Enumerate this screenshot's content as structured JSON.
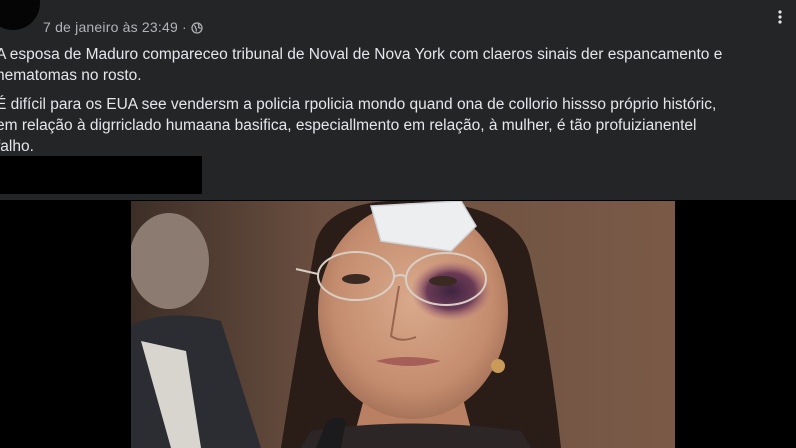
{
  "post": {
    "timestamp": "7 de janeiro às 23:49 ·",
    "paragraphs": [
      "A esposa de Maduro compareceo tribunal de Noval de Nova York com claeros sinais der espancamento e",
      "hematomas no rosto.",
      "É difícil para os EUA see vendersm a policia rpolicia mondo quand ona de collorio hissso próprio históric,",
      "em relação à digrriclado humaana basifica, especiallmento em relação, à mulher, é tão profuizianentel",
      "falho."
    ]
  },
  "icons": {
    "privacy": "globe-icon",
    "menu": "more-options-icon"
  },
  "colors": {
    "card_background": "#242526",
    "page_background": "#000000",
    "primary_text": "#e4e6eb",
    "secondary_text": "#b0b3b8"
  }
}
